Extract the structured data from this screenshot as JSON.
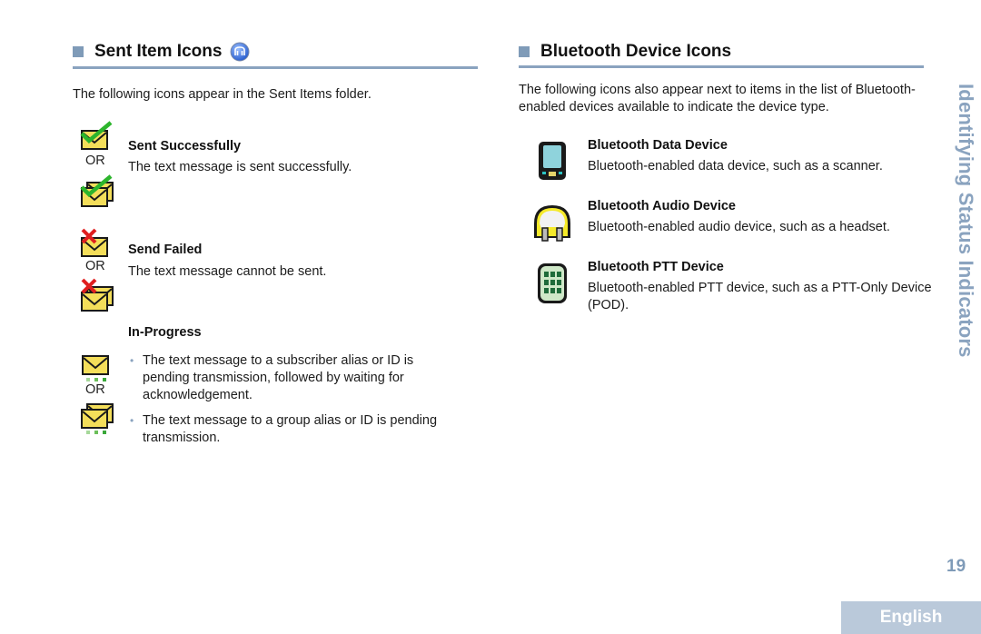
{
  "left_section": {
    "title": "Sent Item Icons",
    "badge_icon": "radio-feature-icon",
    "intro": "The following icons appear in the Sent Items folder.",
    "items": [
      {
        "heading": "Sent Successfully",
        "description": "The text message is sent successfully.",
        "or_label": "OR",
        "icons": [
          "envelope-check-icon",
          "multi-envelope-check-icon"
        ]
      },
      {
        "heading": "Send Failed",
        "description": "The text message cannot be sent.",
        "or_label": "OR",
        "icons": [
          "envelope-x-icon",
          "multi-envelope-x-icon"
        ]
      }
    ],
    "in_progress": {
      "heading": "In-Progress",
      "or_label": "OR",
      "icons": [
        "envelope-pending-icon",
        "multi-envelope-pending-icon"
      ],
      "bullets": [
        "The text message to a subscriber alias or ID is pending transmission, followed by waiting for acknowledgement.",
        "The text message to a group alias or ID is pending transmission."
      ]
    }
  },
  "right_section": {
    "title": "Bluetooth Device Icons",
    "intro": "The following icons also appear next to items in the list of Bluetooth-enabled devices available to indicate the device type.",
    "items": [
      {
        "heading": "Bluetooth Data Device",
        "description": "Bluetooth-enabled data device, such as a scanner.",
        "icon": "data-device-icon"
      },
      {
        "heading": "Bluetooth Audio Device",
        "description": "Bluetooth-enabled audio device, such as a headset.",
        "icon": "headset-icon"
      },
      {
        "heading": "Bluetooth PTT Device",
        "description": "Bluetooth-enabled PTT device, such as a PTT-Only Device (POD).",
        "icon": "ptt-keypad-icon"
      }
    ]
  },
  "side_tab": {
    "title": "Identifying Status Indicators"
  },
  "footer": {
    "page_number": "19",
    "language": "English"
  },
  "colors": {
    "accent": "#8aa3bf",
    "language_tab": "#bac9da",
    "envelope": "#f2dc55",
    "check": "#2db52d",
    "fail": "#e01e1e"
  }
}
